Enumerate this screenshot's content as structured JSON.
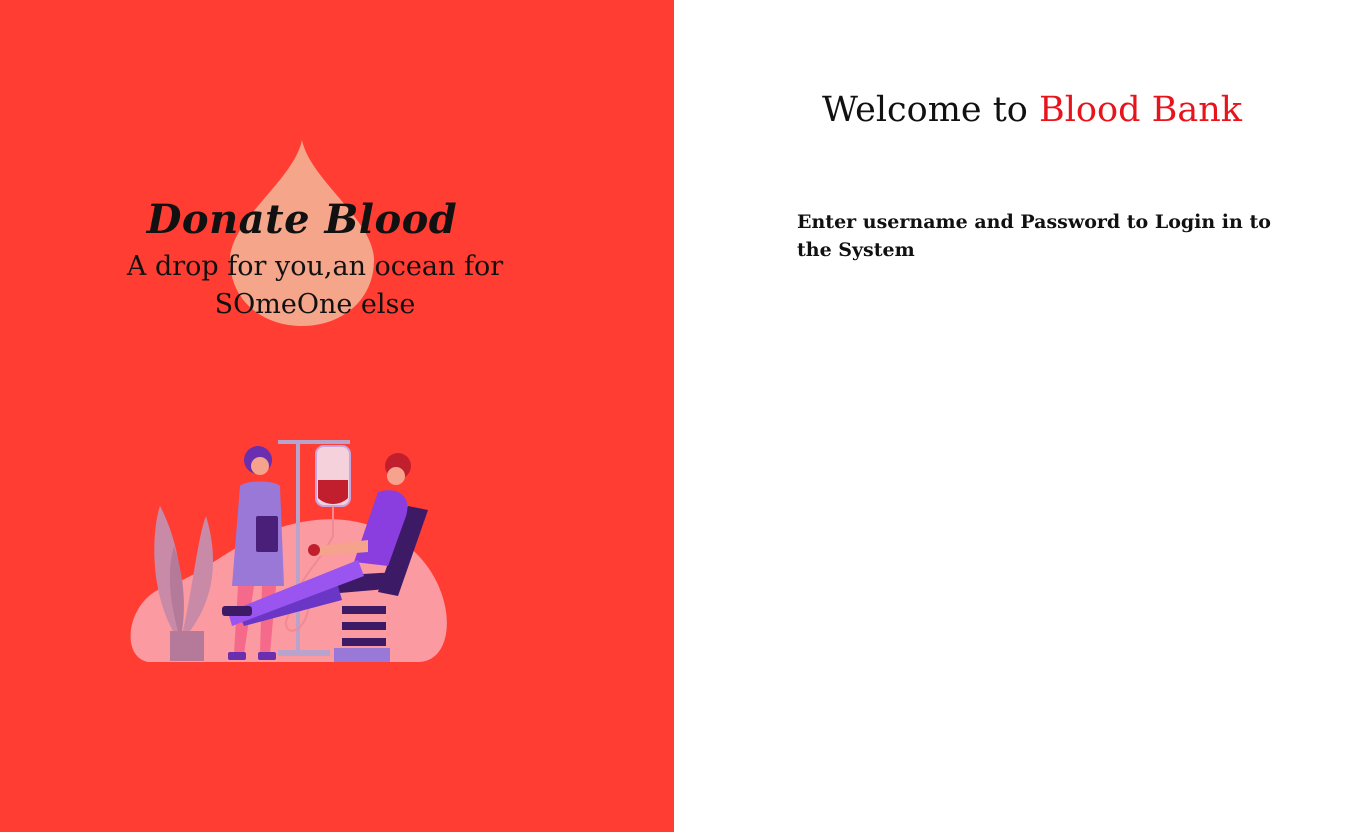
{
  "left_panel": {
    "background_color": "#ff3d33",
    "drop_icon": "blood-drop-icon",
    "title": "Donate Blood",
    "tagline": "A drop for you,an ocean for SOmeOne else",
    "illustration": "blood-donation-illustration"
  },
  "right_panel": {
    "welcome_prefix": "Welcome to",
    "welcome_brand": "Blood Bank",
    "brand_color": "#e8141b",
    "instructions": "Enter username and Password to Login in to the System"
  }
}
